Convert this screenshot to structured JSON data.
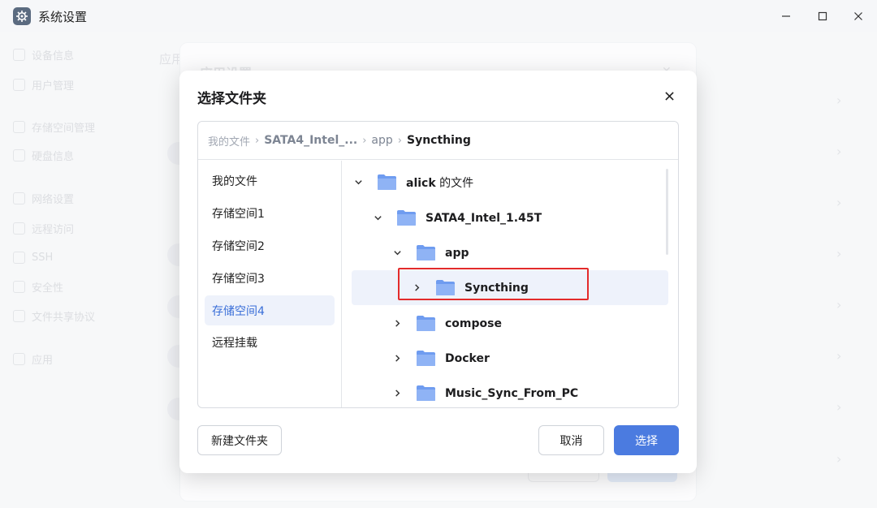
{
  "window": {
    "title": "系统设置",
    "buttons": [
      "minimize-icon",
      "maximize-icon",
      "close-icon"
    ]
  },
  "background": {
    "sidebar": [
      "设备信息",
      "用户管理",
      "存储空间管理",
      "硬盘信息",
      "网络设置",
      "远程访问",
      "SSH",
      "安全性",
      "文件共享协议",
      "应用"
    ],
    "page_heading": "应用",
    "card_title": "应用设置"
  },
  "dialog": {
    "title": "选择文件夹",
    "breadcrumb": {
      "root": "我的文件",
      "disk": "SATA4_Intel_...",
      "folder": "app",
      "current": "Syncthing"
    },
    "locations": [
      {
        "label": "我的文件"
      },
      {
        "label": "存储空间1"
      },
      {
        "label": "存储空间2"
      },
      {
        "label": "存储空间3"
      },
      {
        "label": "存储空间4",
        "selected": true
      },
      {
        "label": "远程挂载"
      }
    ],
    "tree": [
      {
        "name": "alick",
        "suffix": " 的文件",
        "expanded": true,
        "level": 0
      },
      {
        "name": "SATA4_Intel_1.45T",
        "expanded": true,
        "level": 1
      },
      {
        "name": "app",
        "expanded": true,
        "level": 2
      },
      {
        "name": "Syncthing",
        "expanded": false,
        "level": 3,
        "selected": true
      },
      {
        "name": "compose",
        "expanded": false,
        "level": 2
      },
      {
        "name": "Docker",
        "expanded": false,
        "level": 2
      },
      {
        "name": "Music_Sync_From_PC",
        "expanded": false,
        "level": 2
      }
    ],
    "buttons": {
      "new_folder": "新建文件夹",
      "cancel": "取消",
      "select": "选择"
    }
  },
  "colors": {
    "accent": "#4b7be0",
    "highlight": "#e32b2b",
    "folder": "#8fb3f5"
  }
}
